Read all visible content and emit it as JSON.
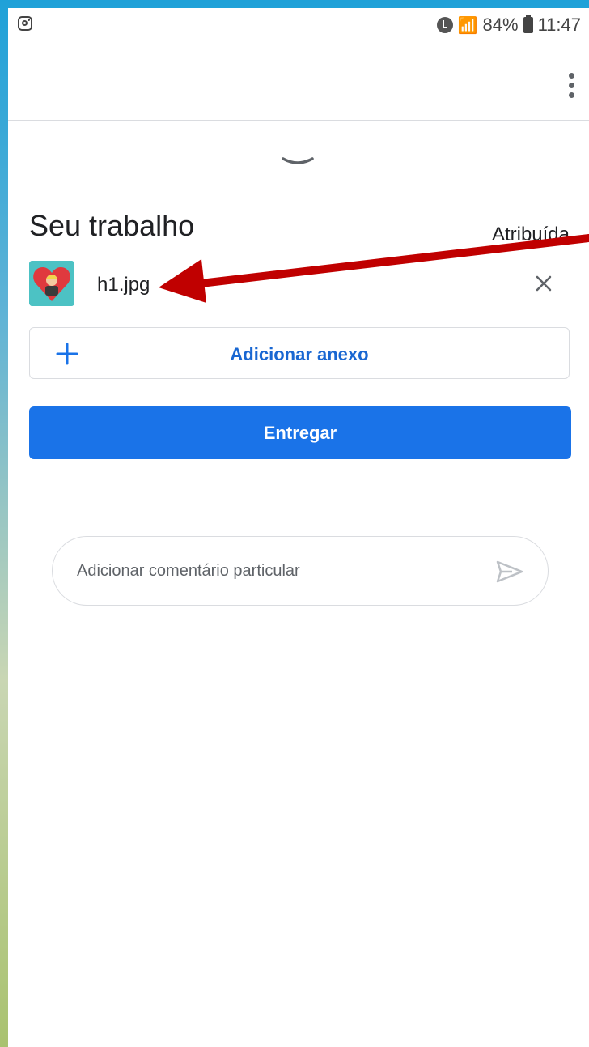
{
  "status_bar": {
    "battery": "84%",
    "time": "11:47"
  },
  "assignment": {
    "section_title": "Seu trabalho",
    "status": "Atribuída",
    "attachment": {
      "file_name": "h1.jpg"
    },
    "add_attachment_label": "Adicionar anexo",
    "submit_label": "Entregar"
  },
  "comment": {
    "placeholder": "Adicionar comentário particular"
  },
  "colors": {
    "primary": "#1a73e8",
    "primary_text": "#1967d2",
    "annotation_arrow": "#c00000"
  },
  "icons": [
    "instagram-icon",
    "alarm-icon",
    "wifi-icon",
    "battery-icon",
    "more-vert-icon",
    "chevron-down-icon",
    "close-icon",
    "plus-icon",
    "send-icon"
  ]
}
